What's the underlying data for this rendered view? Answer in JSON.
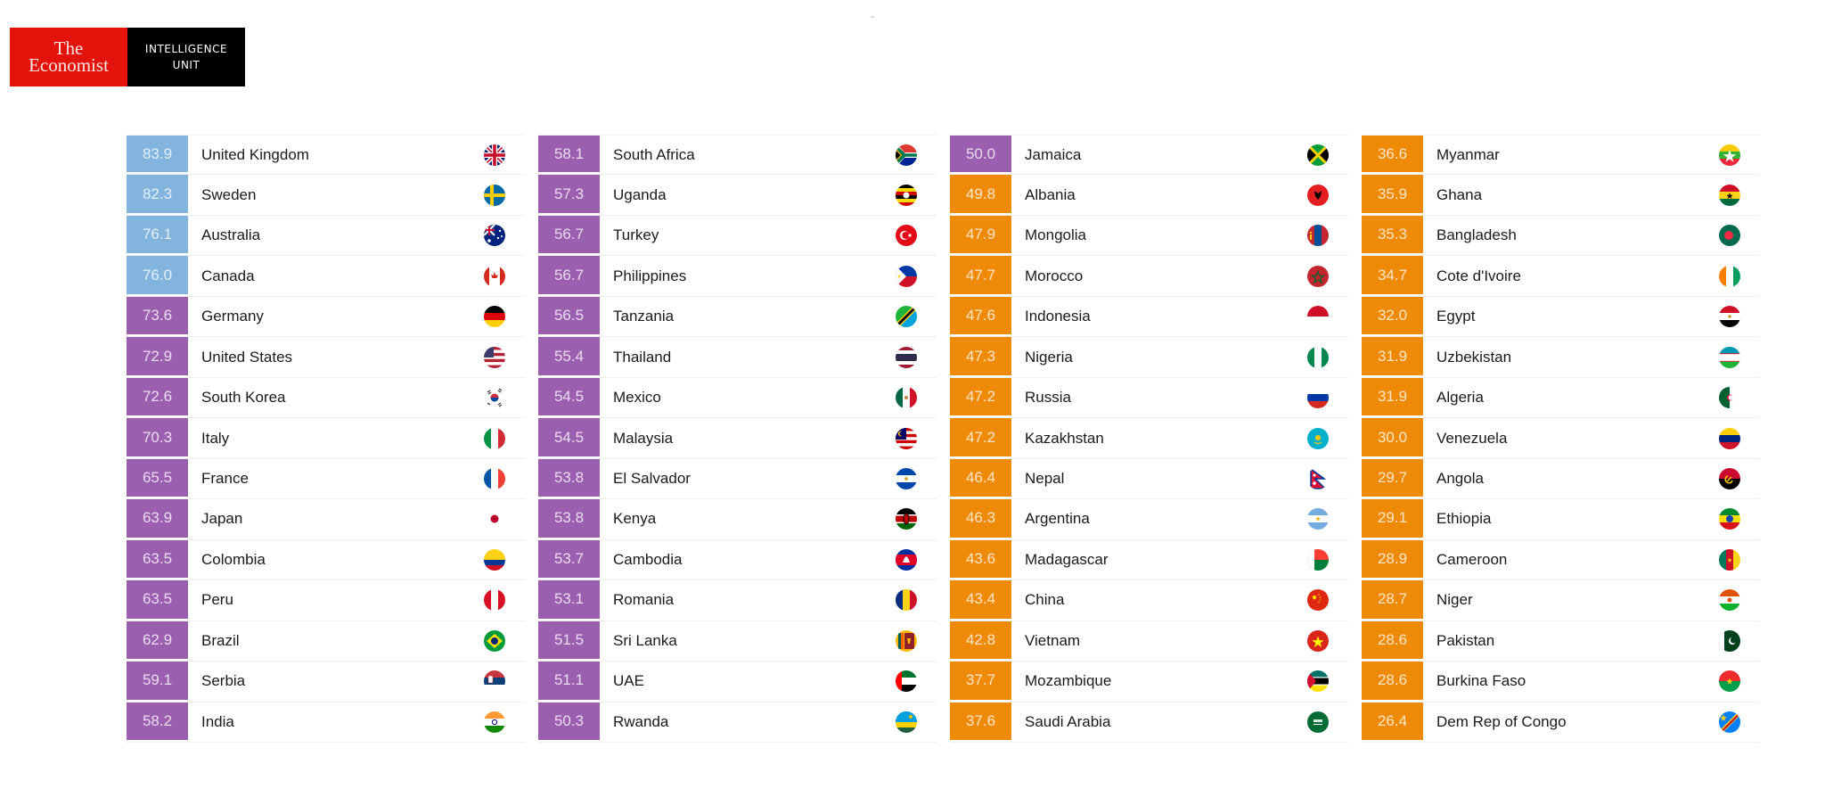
{
  "logo": {
    "left_line1": "The",
    "left_line2": "Economist",
    "right_line1": "INTELLIGENCE",
    "right_line2": "UNIT"
  },
  "colors": {
    "tier_light_blue": "#82b4de",
    "tier_purple": "#9b5fb0",
    "tier_orange": "#ee8a05",
    "logo_red": "#e3120b",
    "logo_black": "#000000"
  },
  "chart_data": {
    "type": "table",
    "title": "",
    "columns": [
      "score",
      "country",
      "flag"
    ],
    "rows": [
      {
        "score": "83.9",
        "country": "United Kingdom",
        "tier": "light_blue",
        "flag": "gb"
      },
      {
        "score": "82.3",
        "country": "Sweden",
        "tier": "light_blue",
        "flag": "se"
      },
      {
        "score": "76.1",
        "country": "Australia",
        "tier": "light_blue",
        "flag": "au"
      },
      {
        "score": "76.0",
        "country": "Canada",
        "tier": "light_blue",
        "flag": "ca"
      },
      {
        "score": "73.6",
        "country": "Germany",
        "tier": "purple",
        "flag": "de"
      },
      {
        "score": "72.9",
        "country": "United States",
        "tier": "purple",
        "flag": "us"
      },
      {
        "score": "72.6",
        "country": "South Korea",
        "tier": "purple",
        "flag": "kr"
      },
      {
        "score": "70.3",
        "country": "Italy",
        "tier": "purple",
        "flag": "it"
      },
      {
        "score": "65.5",
        "country": "France",
        "tier": "purple",
        "flag": "fr"
      },
      {
        "score": "63.9",
        "country": "Japan",
        "tier": "purple",
        "flag": "jp"
      },
      {
        "score": "63.5",
        "country": "Colombia",
        "tier": "purple",
        "flag": "co"
      },
      {
        "score": "63.5",
        "country": "Peru",
        "tier": "purple",
        "flag": "pe"
      },
      {
        "score": "62.9",
        "country": "Brazil",
        "tier": "purple",
        "flag": "br"
      },
      {
        "score": "59.1",
        "country": "Serbia",
        "tier": "purple",
        "flag": "rs"
      },
      {
        "score": "58.2",
        "country": "India",
        "tier": "purple",
        "flag": "in"
      },
      {
        "score": "58.1",
        "country": "South Africa",
        "tier": "purple",
        "flag": "za"
      },
      {
        "score": "57.3",
        "country": "Uganda",
        "tier": "purple",
        "flag": "ug"
      },
      {
        "score": "56.7",
        "country": "Turkey",
        "tier": "purple",
        "flag": "tr"
      },
      {
        "score": "56.7",
        "country": "Philippines",
        "tier": "purple",
        "flag": "ph"
      },
      {
        "score": "56.5",
        "country": "Tanzania",
        "tier": "purple",
        "flag": "tz"
      },
      {
        "score": "55.4",
        "country": "Thailand",
        "tier": "purple",
        "flag": "th"
      },
      {
        "score": "54.5",
        "country": "Mexico",
        "tier": "purple",
        "flag": "mx"
      },
      {
        "score": "54.5",
        "country": "Malaysia",
        "tier": "purple",
        "flag": "my"
      },
      {
        "score": "53.8",
        "country": "El Salvador",
        "tier": "purple",
        "flag": "sv"
      },
      {
        "score": "53.8",
        "country": "Kenya",
        "tier": "purple",
        "flag": "ke"
      },
      {
        "score": "53.7",
        "country": "Cambodia",
        "tier": "purple",
        "flag": "kh"
      },
      {
        "score": "53.1",
        "country": "Romania",
        "tier": "purple",
        "flag": "ro"
      },
      {
        "score": "51.5",
        "country": "Sri Lanka",
        "tier": "purple",
        "flag": "lk"
      },
      {
        "score": "51.1",
        "country": "UAE",
        "tier": "purple",
        "flag": "ae"
      },
      {
        "score": "50.3",
        "country": "Rwanda",
        "tier": "purple",
        "flag": "rw"
      },
      {
        "score": "50.0",
        "country": "Jamaica",
        "tier": "purple",
        "flag": "jm"
      },
      {
        "score": "49.8",
        "country": "Albania",
        "tier": "orange",
        "flag": "al"
      },
      {
        "score": "47.9",
        "country": "Mongolia",
        "tier": "orange",
        "flag": "mn"
      },
      {
        "score": "47.7",
        "country": "Morocco",
        "tier": "orange",
        "flag": "ma"
      },
      {
        "score": "47.6",
        "country": "Indonesia",
        "tier": "orange",
        "flag": "id"
      },
      {
        "score": "47.3",
        "country": "Nigeria",
        "tier": "orange",
        "flag": "ng"
      },
      {
        "score": "47.2",
        "country": "Russia",
        "tier": "orange",
        "flag": "ru"
      },
      {
        "score": "47.2",
        "country": "Kazakhstan",
        "tier": "orange",
        "flag": "kz"
      },
      {
        "score": "46.4",
        "country": "Nepal",
        "tier": "orange",
        "flag": "np"
      },
      {
        "score": "46.3",
        "country": "Argentina",
        "tier": "orange",
        "flag": "ar"
      },
      {
        "score": "43.6",
        "country": "Madagascar",
        "tier": "orange",
        "flag": "mg"
      },
      {
        "score": "43.4",
        "country": "China",
        "tier": "orange",
        "flag": "cn"
      },
      {
        "score": "42.8",
        "country": "Vietnam",
        "tier": "orange",
        "flag": "vn"
      },
      {
        "score": "37.7",
        "country": "Mozambique",
        "tier": "orange",
        "flag": "mz"
      },
      {
        "score": "37.6",
        "country": "Saudi Arabia",
        "tier": "orange",
        "flag": "sa"
      },
      {
        "score": "36.6",
        "country": "Myanmar",
        "tier": "orange",
        "flag": "mm"
      },
      {
        "score": "35.9",
        "country": "Ghana",
        "tier": "orange",
        "flag": "gh"
      },
      {
        "score": "35.3",
        "country": "Bangladesh",
        "tier": "orange",
        "flag": "bd"
      },
      {
        "score": "34.7",
        "country": "Cote d'Ivoire",
        "tier": "orange",
        "flag": "ci"
      },
      {
        "score": "32.0",
        "country": "Egypt",
        "tier": "orange",
        "flag": "eg"
      },
      {
        "score": "31.9",
        "country": "Uzbekistan",
        "tier": "orange",
        "flag": "uz"
      },
      {
        "score": "31.9",
        "country": "Algeria",
        "tier": "orange",
        "flag": "dz"
      },
      {
        "score": "30.0",
        "country": "Venezuela",
        "tier": "orange",
        "flag": "ve"
      },
      {
        "score": "29.7",
        "country": "Angola",
        "tier": "orange",
        "flag": "ao"
      },
      {
        "score": "29.1",
        "country": "Ethiopia",
        "tier": "orange",
        "flag": "et"
      },
      {
        "score": "28.9",
        "country": "Cameroon",
        "tier": "orange",
        "flag": "cm"
      },
      {
        "score": "28.7",
        "country": "Niger",
        "tier": "orange",
        "flag": "ne"
      },
      {
        "score": "28.6",
        "country": "Pakistan",
        "tier": "orange",
        "flag": "pk"
      },
      {
        "score": "28.6",
        "country": "Burkina Faso",
        "tier": "orange",
        "flag": "bf"
      },
      {
        "score": "26.4",
        "country": "Dem Rep of Congo",
        "tier": "orange",
        "flag": "cd"
      }
    ],
    "rows_per_column": 15,
    "column_count": 4
  }
}
